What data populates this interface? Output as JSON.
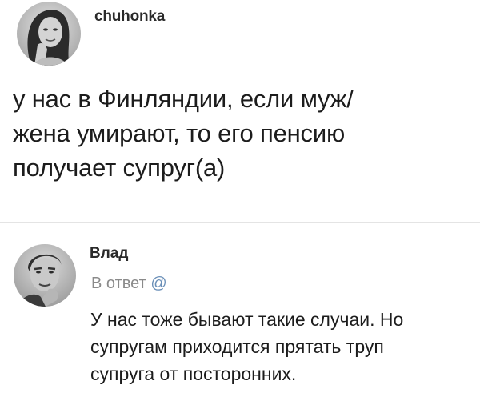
{
  "post": {
    "username": "chuhonka",
    "text": "у нас в Финляндии, если муж/\nжена умирают, то его пенсию\nполучает супруг(а)"
  },
  "reply": {
    "username": "Влад",
    "reply_to_label": "В ответ",
    "mention_symbol": "@",
    "text": "У нас тоже бывают такие случаи. Но\nсупругам приходится прятать труп\nсупруга от посторонних."
  },
  "icons": {
    "avatar_1": "user-avatar-woman-icon",
    "avatar_2": "user-avatar-man-icon"
  },
  "colors": {
    "background": "#ffffff",
    "text": "#1c1c1c",
    "muted": "#8a8a8a",
    "mention": "#6a8fb8",
    "divider": "#e4e4e4"
  }
}
